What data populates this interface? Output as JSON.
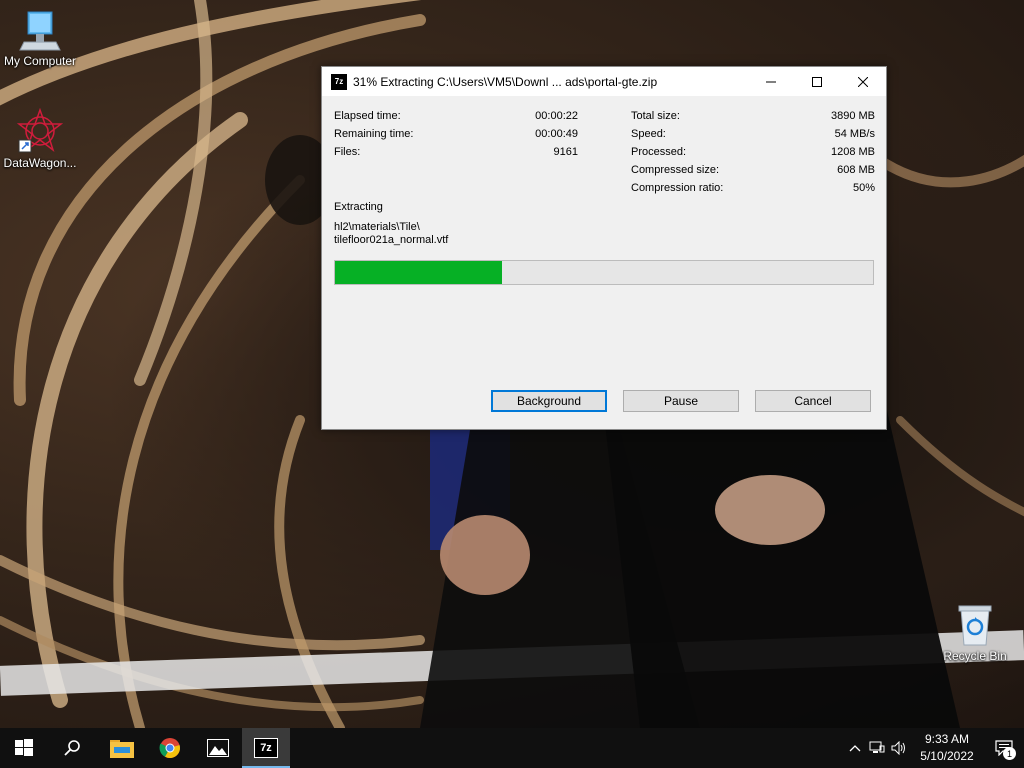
{
  "desktop": {
    "icons": [
      {
        "label": "My Computer",
        "icon": "computer-icon"
      },
      {
        "label": "DataWagon...",
        "icon": "datawagon-icon"
      },
      {
        "label": "Recycle Bin",
        "icon": "recycle-bin-icon"
      }
    ]
  },
  "window": {
    "title": "31% Extracting C:\\Users\\VM5\\Downl ... ads\\portal-gte.zip",
    "app_icon_text": "7z",
    "controls": {
      "minimize": "—",
      "maximize": "☐",
      "close": "✕"
    },
    "stats_left": [
      {
        "label": "Elapsed time:",
        "value": "00:00:22"
      },
      {
        "label": "Remaining time:",
        "value": "00:00:49"
      },
      {
        "label": "Files:",
        "value": "9161"
      }
    ],
    "stats_right": [
      {
        "label": "Total size:",
        "value": "3890 MB"
      },
      {
        "label": "Speed:",
        "value": "54 MB/s"
      },
      {
        "label": "Processed:",
        "value": "1208 MB"
      },
      {
        "label": "Compressed size:",
        "value": "608 MB"
      },
      {
        "label": "Compression ratio:",
        "value": "50%"
      }
    ],
    "extracting_label": "Extracting",
    "current_path": "hl2\\materials\\Tile\\",
    "current_file": "tilefloor021a_normal.vtf",
    "progress_fraction": 0.31,
    "progress_color": "#06b025",
    "buttons": {
      "background": "Background",
      "pause": "Pause",
      "cancel": "Cancel"
    }
  },
  "taskbar": {
    "apps": [
      "start-icon",
      "search-icon",
      "file-explorer-icon",
      "chrome-icon",
      "photos-icon",
      "7zip-icon"
    ],
    "active_app": "7zip-icon",
    "app_7z_text": "7z",
    "clock_time": "9:33 AM",
    "clock_date": "5/10/2022",
    "notification_count": "1"
  }
}
